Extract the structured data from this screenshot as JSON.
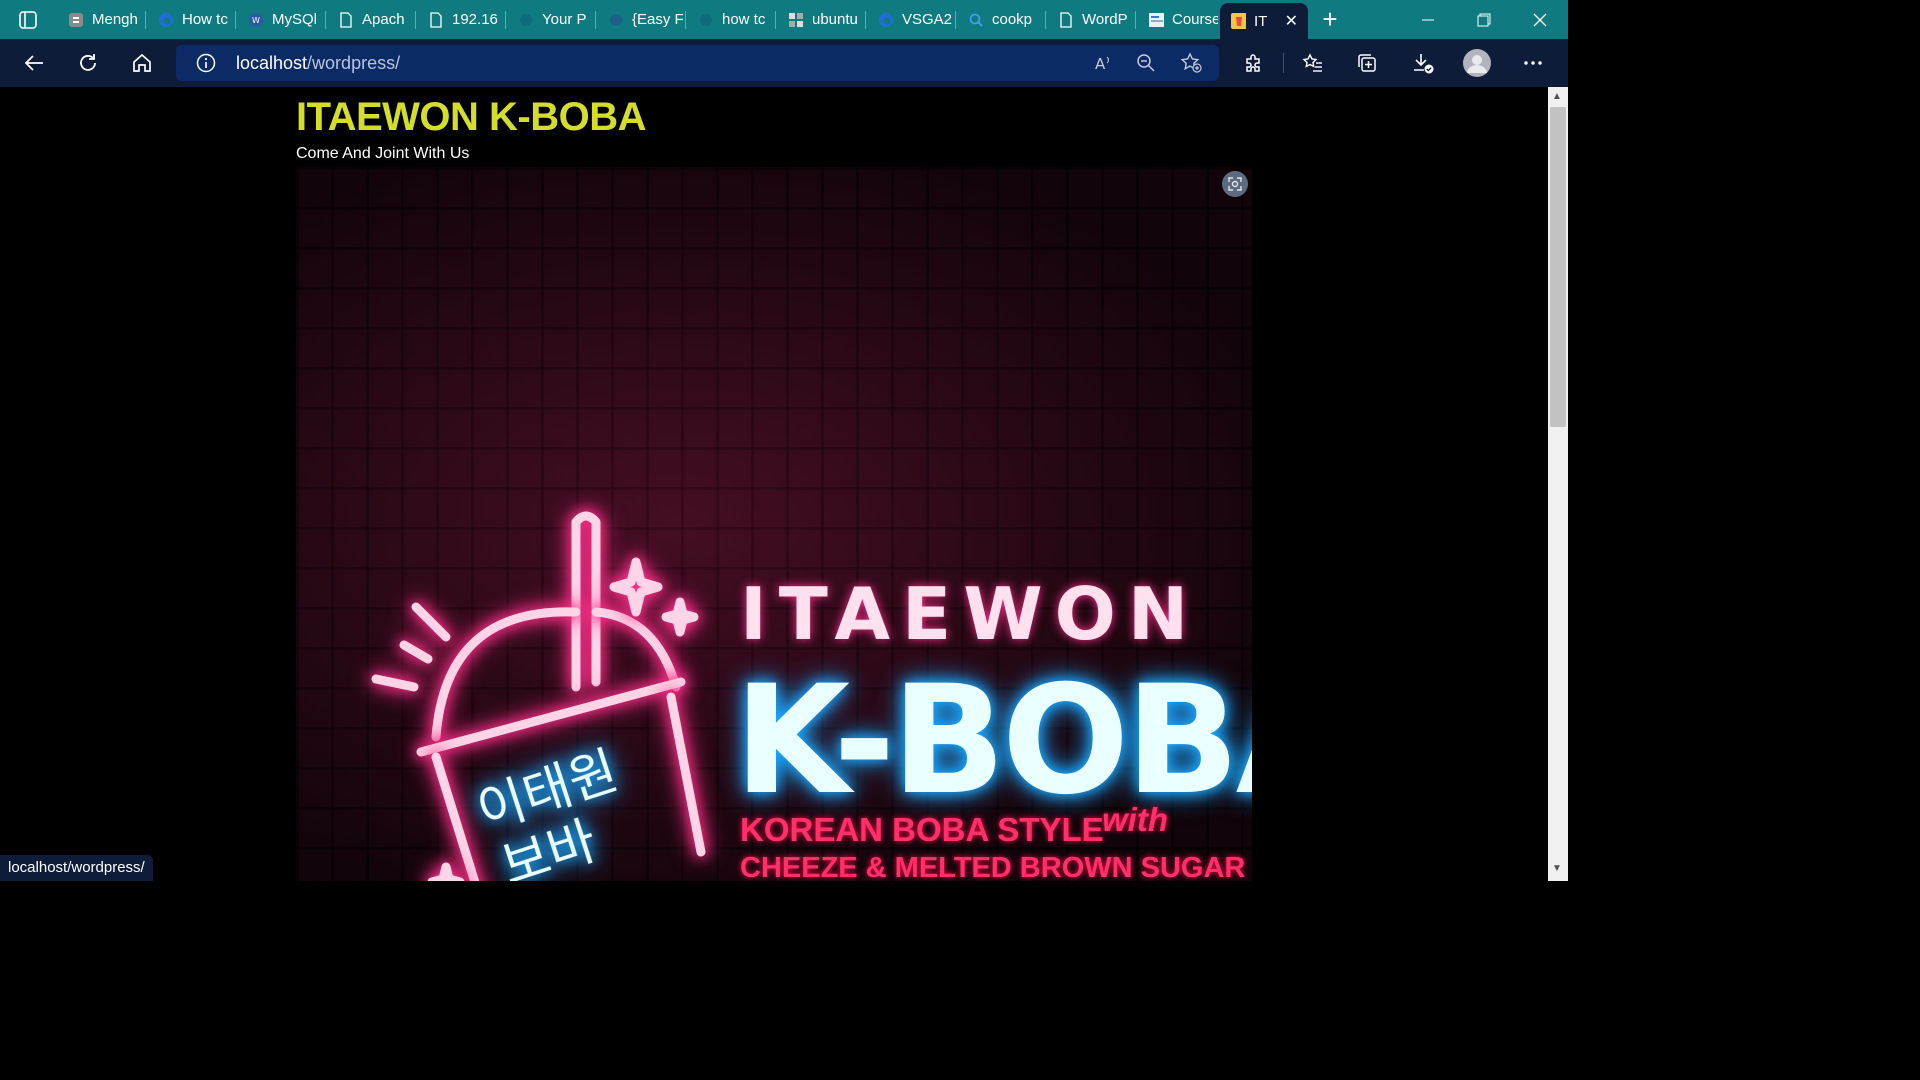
{
  "browser": {
    "tabs": [
      {
        "title": "Mengh",
        "icon": "blogger-icon"
      },
      {
        "title": "How tc",
        "icon": "edge-icon"
      },
      {
        "title": "MySQl",
        "icon": "wordpress-icon"
      },
      {
        "title": "Apach",
        "icon": "page-icon"
      },
      {
        "title": "192.16",
        "icon": "page-icon"
      },
      {
        "title": "Your P",
        "icon": "blank-icon"
      },
      {
        "title": "{Easy F",
        "icon": "globe-icon"
      },
      {
        "title": "how tc",
        "icon": "blank-icon"
      },
      {
        "title": "ubuntu",
        "icon": "ubuntu-icon"
      },
      {
        "title": "VSGA2",
        "icon": "edge-icon"
      },
      {
        "title": "cookp",
        "icon": "search-icon"
      },
      {
        "title": "WordP",
        "icon": "page-icon"
      },
      {
        "title": "Course",
        "icon": "course-icon"
      },
      {
        "title": "IT",
        "icon": "boba-icon",
        "active": true
      }
    ],
    "address": {
      "host": "localhost",
      "path": "/wordpress/"
    },
    "status_url": "localhost/wordpress/"
  },
  "site": {
    "title": "ITAEWON K-BOBA",
    "tagline": "Come And Joint With Us"
  },
  "banner": {
    "line1": "ITAEWON",
    "line2": "K-BOBA",
    "line3": "KOREAN BOBA STYLE",
    "line3_with": "with",
    "line4": "CHEEZE & MELTED BROWN SUGAR",
    "korean1": "이태원",
    "korean2": "보바"
  }
}
